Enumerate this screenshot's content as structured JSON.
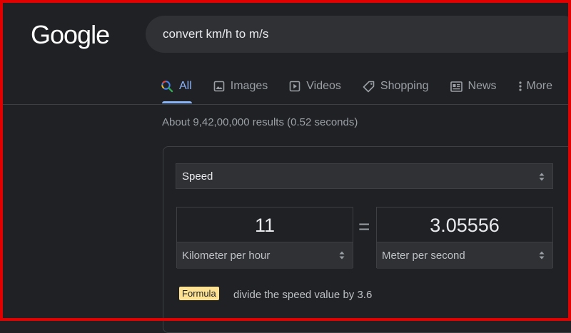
{
  "logo": "Google",
  "search": {
    "query": "convert km/h to m/s"
  },
  "tabs": [
    {
      "label": "All",
      "icon": "search-icon",
      "active": true
    },
    {
      "label": "Images",
      "icon": "image-icon"
    },
    {
      "label": "Videos",
      "icon": "play-icon"
    },
    {
      "label": "Shopping",
      "icon": "tag-icon"
    },
    {
      "label": "News",
      "icon": "news-icon"
    },
    {
      "label": "More",
      "icon": "more-vert-icon"
    }
  ],
  "results_stats": "About 9,42,00,000 results (0.52 seconds)",
  "converter": {
    "category": "Speed",
    "equals": "=",
    "from": {
      "value": "11",
      "unit": "Kilometer per hour"
    },
    "to": {
      "value": "3.05556",
      "unit": "Meter per second"
    },
    "formula_label": "Formula",
    "formula_text": "divide the speed value by 3.6"
  },
  "colors": {
    "background": "#202124",
    "accent": "#8ab4f8",
    "formula_badge": "#fde293",
    "frame": "#e00000"
  }
}
